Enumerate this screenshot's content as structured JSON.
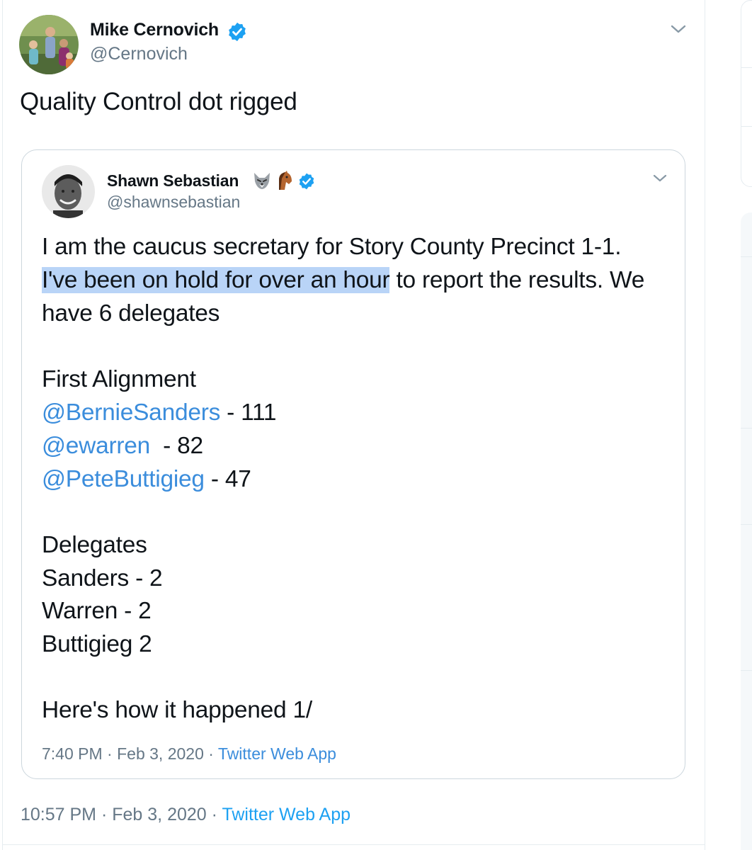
{
  "tweet": {
    "author_name": "Mike Cernovich",
    "author_handle": "@Cernovich",
    "text": "Quality Control dot rigged",
    "time": "10:57 PM",
    "date": "Feb 3, 2020",
    "source": "Twitter Web App",
    "separator": "·"
  },
  "quoted": {
    "author_name": "Shawn Sebastian",
    "author_handle": "@shawnsebastian",
    "line1": "I am the caucus secretary for Story County Precinct 1-1.",
    "line2_highlight": "I've been on hold for over an hour",
    "line2_rest": " to report the results. We",
    "line3": "have 6 delegates",
    "alignment_title": "First Alignment",
    "alignment": [
      {
        "mention": "@BernieSanders",
        "value": " - 111"
      },
      {
        "mention": "@ewarren",
        "value": "  - 82"
      },
      {
        "mention": "@PeteButtigieg",
        "value": " - 47"
      }
    ],
    "delegates_title": "Delegates",
    "delegates": [
      "Sanders - 2",
      "Warren - 2",
      "Buttigieg 2"
    ],
    "closing": "Here's how it happened 1/",
    "time": "7:40 PM",
    "date": "Feb 3, 2020",
    "source": "Twitter Web App",
    "separator": "·"
  },
  "colors": {
    "link": "#3b8ddc",
    "muted": "#657786",
    "verified": "#1da1f2",
    "highlight": "#b9d4f7"
  },
  "icons": [
    "verified-badge-icon",
    "chevron-down-icon",
    "wolf-emoji-icon",
    "horse-emoji-icon"
  ]
}
